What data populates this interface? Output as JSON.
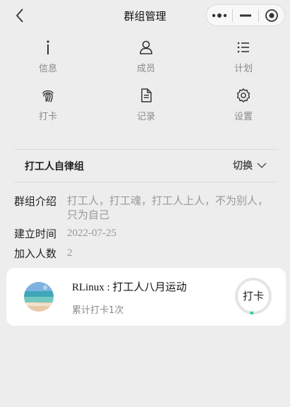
{
  "nav": {
    "title": "群组管理",
    "back_icon": "chevron-left-icon",
    "more_icon": "more-dots-icon",
    "minimize_icon": "minimize-icon",
    "close_icon": "target-close-icon"
  },
  "grid": {
    "items": [
      {
        "label": "信息",
        "icon": "info-icon"
      },
      {
        "label": "成员",
        "icon": "user-icon"
      },
      {
        "label": "计划",
        "icon": "list-icon"
      },
      {
        "label": "打卡",
        "icon": "fingerprint-icon"
      },
      {
        "label": "记录",
        "icon": "document-icon"
      },
      {
        "label": "设置",
        "icon": "gear-icon"
      }
    ]
  },
  "group": {
    "name": "打工人自律组",
    "switch_label": "切换",
    "switch_icon": "chevron-down-icon"
  },
  "info": {
    "intro_label": "群组介绍",
    "intro_value": "打工人，打工魂，打工人上人，不为别人，只为自己",
    "created_label": "建立时间",
    "created_value": "2022-07-25",
    "members_label": "加入人数",
    "members_value": "2"
  },
  "card": {
    "title": "RLinux : 打工人八月运动",
    "subtitle": "累计打卡1次",
    "checkin_label": "打卡",
    "progress_fraction": 0.03,
    "progress_color": "#3cc9a0"
  },
  "colors": {
    "background": "#ededed",
    "card": "#ffffff",
    "muted_text": "#999999"
  }
}
